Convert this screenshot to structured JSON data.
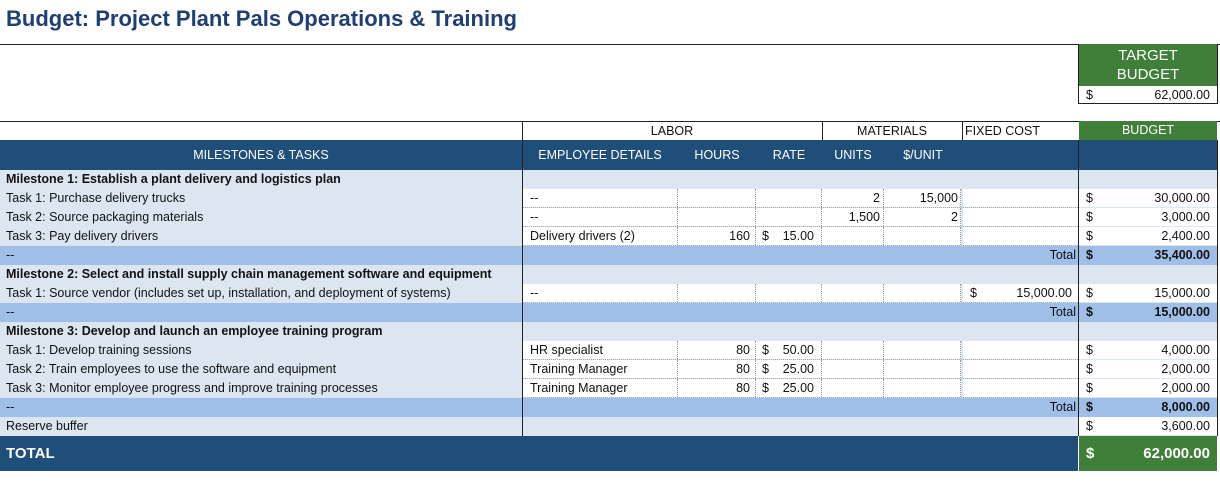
{
  "title": "Budget: Project Plant Pals Operations & Training",
  "target": {
    "label_line1": "TARGET",
    "label_line2": "BUDGET",
    "currency": "$",
    "amount": "62,000.00"
  },
  "group_headers": {
    "labor": "LABOR",
    "materials": "MATERIALS",
    "fixed_cost": "FIXED COST",
    "budget": "BUDGET"
  },
  "columns": {
    "tasks": "MILESTONES & TASKS",
    "employee": "EMPLOYEE DETAILS",
    "hours": "HOURS",
    "rate": "RATE",
    "units": "UNITS",
    "per_unit": "$/UNIT"
  },
  "milestones": [
    {
      "title": "Milestone 1: Establish a plant delivery and logistics plan",
      "tasks": [
        {
          "name": "Task 1: Purchase delivery trucks",
          "employee": "--",
          "hours": "",
          "rate_sym": "",
          "rate": "",
          "units": "2",
          "per_unit": "15,000",
          "fc_sym": "",
          "fc": "",
          "cur": "$",
          "budget": "30,000.00"
        },
        {
          "name": "Task 2: Source packaging materials",
          "employee": "--",
          "hours": "",
          "rate_sym": "",
          "rate": "",
          "units": "1,500",
          "per_unit": "2",
          "fc_sym": "",
          "fc": "",
          "cur": "$",
          "budget": "3,000.00"
        },
        {
          "name": "Task 3: Pay delivery drivers",
          "employee": "Delivery drivers (2)",
          "hours": "160",
          "rate_sym": "$",
          "rate": "15.00",
          "units": "",
          "per_unit": "",
          "fc_sym": "",
          "fc": "",
          "cur": "$",
          "budget": "2,400.00"
        }
      ],
      "total_prefix": "--",
      "total_label": "Total",
      "total_cur": "$",
      "total": "35,400.00"
    },
    {
      "title": "Milestone 2: Select and install supply chain management software and equipment",
      "tasks": [
        {
          "name": "Task 1: Source vendor (includes set up, installation, and deployment of systems)",
          "employee": "--",
          "hours": "",
          "rate_sym": "",
          "rate": "",
          "units": "",
          "per_unit": "",
          "fc_sym": "$",
          "fc": "15,000.00",
          "cur": "$",
          "budget": "15,000.00"
        }
      ],
      "total_prefix": "--",
      "total_label": "Total",
      "total_cur": "$",
      "total": "15,000.00"
    },
    {
      "title": "Milestone 3: Develop and launch an employee training program",
      "tasks": [
        {
          "name": "Task 1: Develop training sessions",
          "employee": "HR specialist",
          "hours": "80",
          "rate_sym": "$",
          "rate": "50.00",
          "units": "",
          "per_unit": "",
          "fc_sym": "",
          "fc": "",
          "cur": "$",
          "budget": "4,000.00"
        },
        {
          "name": "Task 2: Train employees to use the software and equipment",
          "employee": "Training Manager",
          "hours": "80",
          "rate_sym": "$",
          "rate": "25.00",
          "units": "",
          "per_unit": "",
          "fc_sym": "",
          "fc": "",
          "cur": "$",
          "budget": "2,000.00"
        },
        {
          "name": "Task 3: Monitor employee progress and improve training processes",
          "employee": "Training Manager",
          "hours": "80",
          "rate_sym": "$",
          "rate": "25.00",
          "units": "",
          "per_unit": "",
          "fc_sym": "",
          "fc": "",
          "cur": "$",
          "budget": "2,000.00"
        }
      ],
      "total_prefix": "--",
      "total_label": "Total",
      "total_cur": "$",
      "total": "8,000.00"
    }
  ],
  "reserve": {
    "label": "Reserve buffer",
    "cur": "$",
    "amount": "3,600.00"
  },
  "grand_total": {
    "label": "TOTAL",
    "cur": "$",
    "amount": "62,000.00"
  },
  "colors": {
    "navy": "#1f4e79",
    "green": "#3f7f3a",
    "light_blue": "#dce6f1",
    "mid_blue": "#9fbfe8",
    "title": "#1f3f73"
  }
}
